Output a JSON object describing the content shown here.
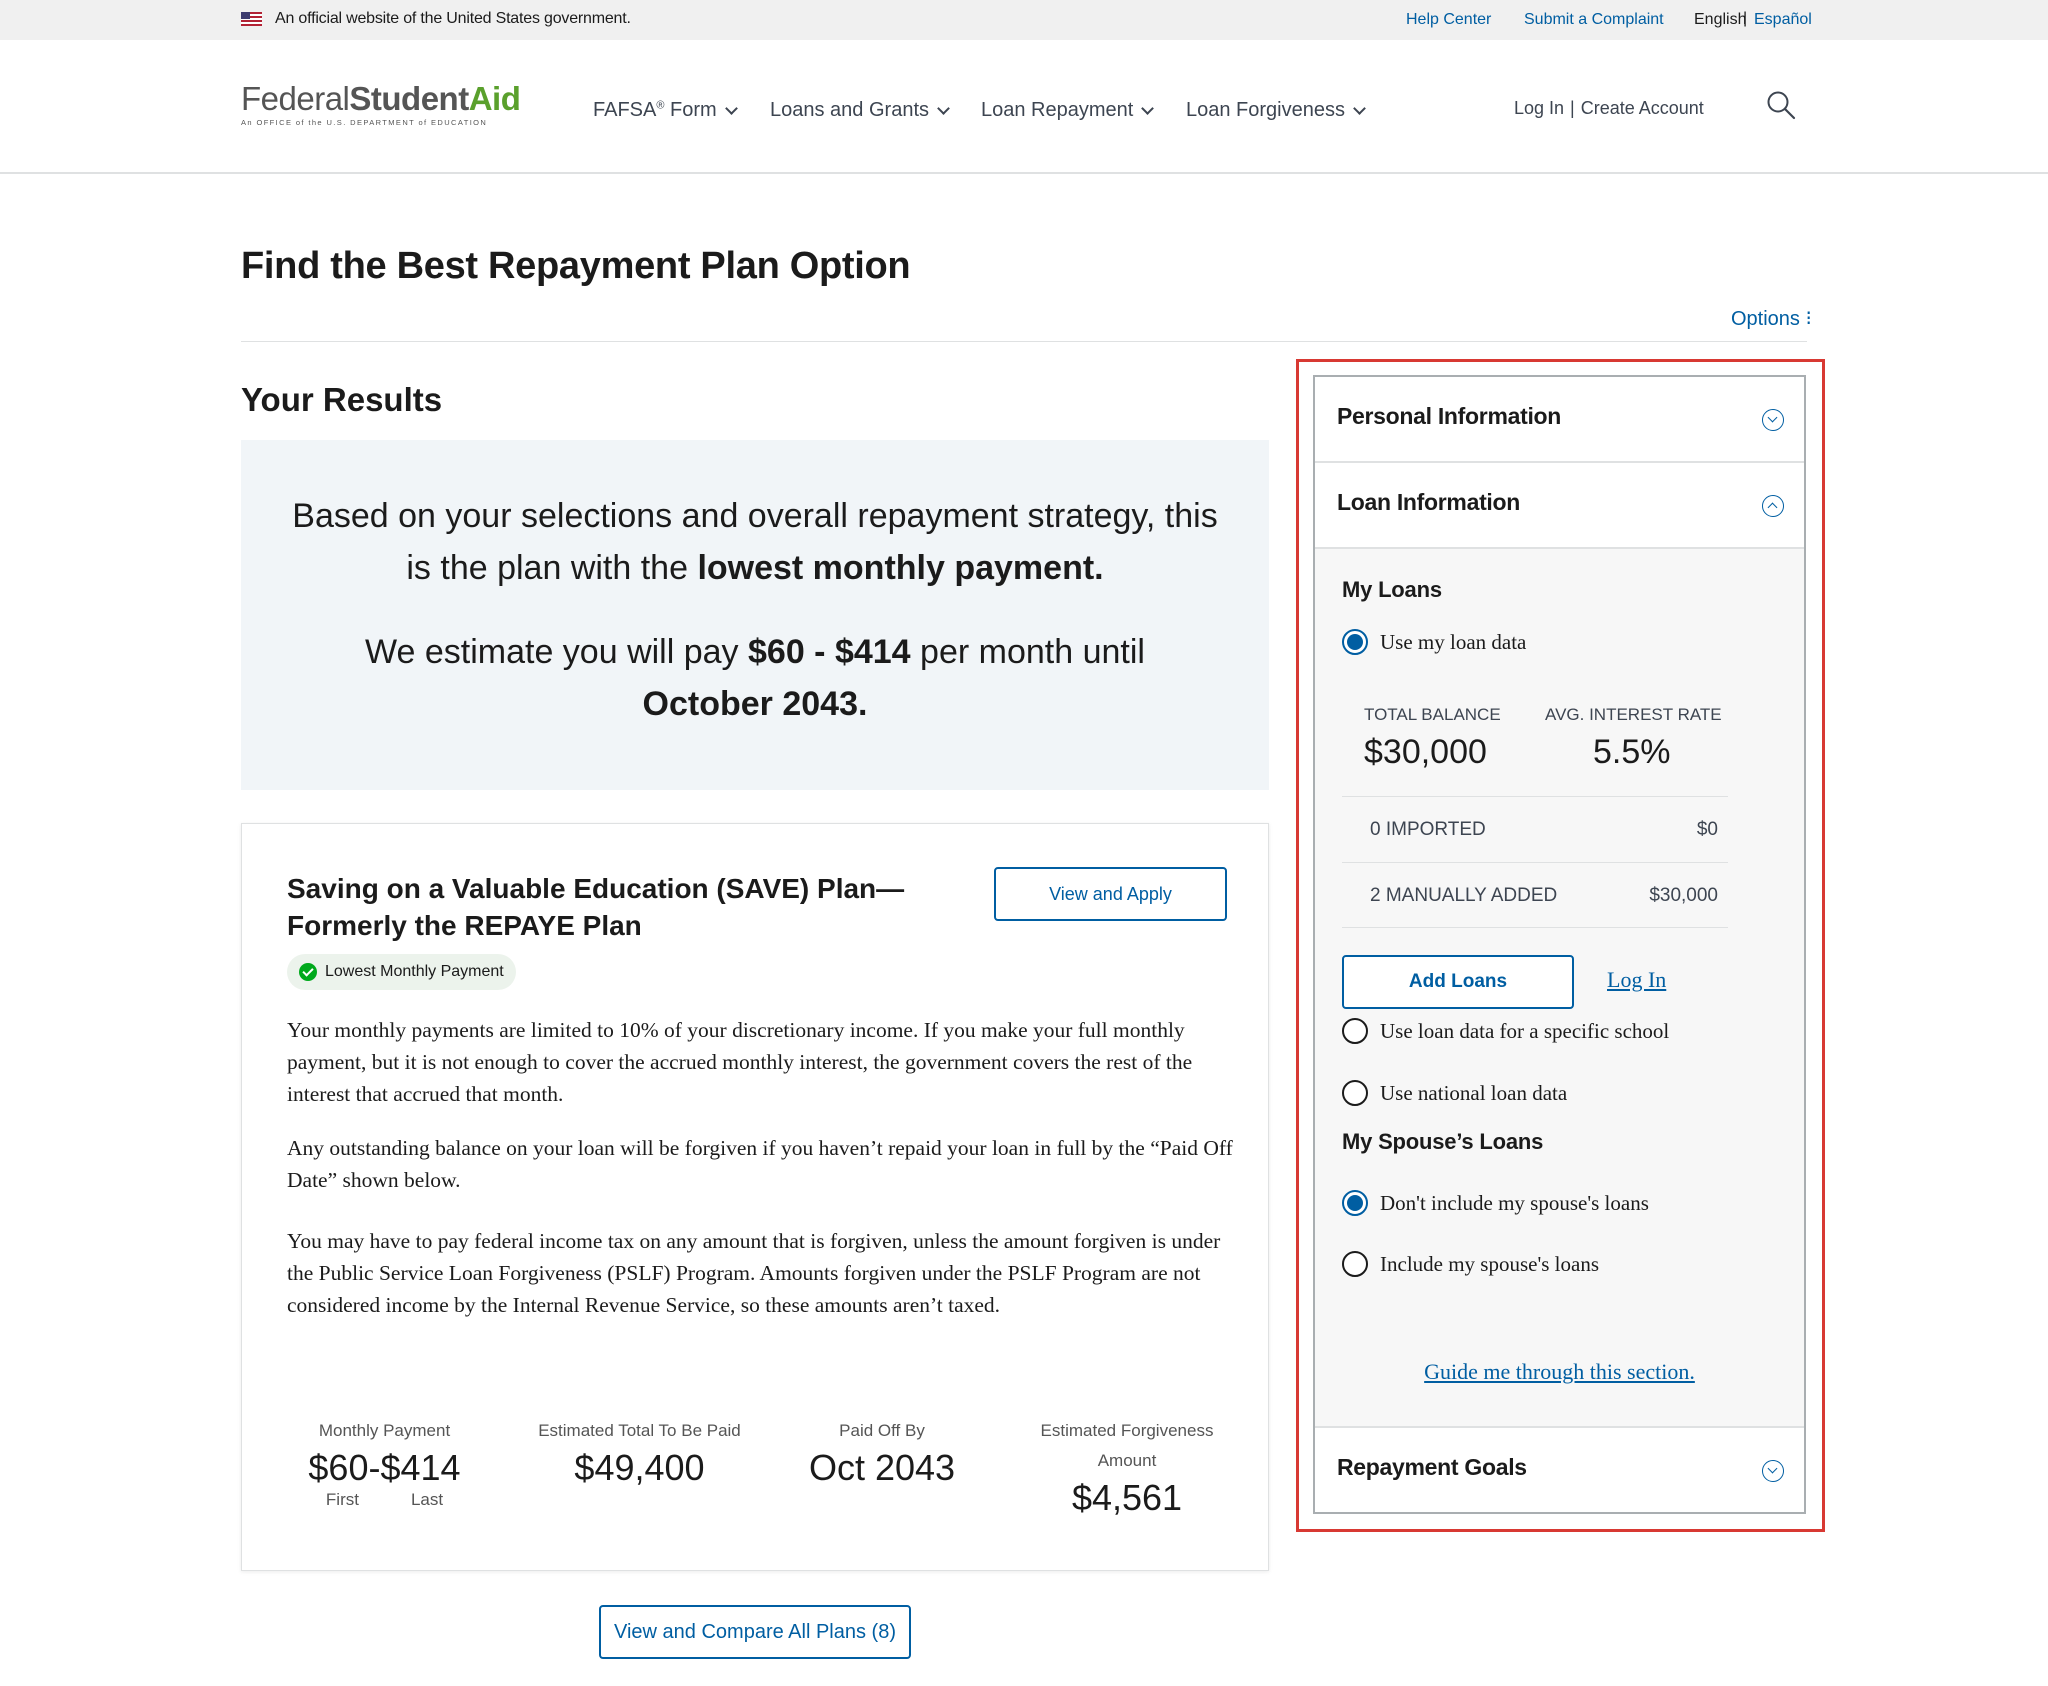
{
  "gov_banner": {
    "text": "An official website of the United States government.",
    "help_center": "Help Center",
    "submit_complaint": "Submit a Complaint",
    "english": "English",
    "separator": "|",
    "espanol": "Español"
  },
  "header": {
    "logo_federal": "Federal",
    "logo_student": "Student",
    "logo_aid": "Aid",
    "logo_sub": "An OFFICE of the U.S. DEPARTMENT of EDUCATION",
    "nav": {
      "fafsa": "FAFSA",
      "fafsa_sup": "®",
      "fafsa_suffix": "Form",
      "loans_grants": "Loans and Grants",
      "loan_repayment": "Loan Repayment",
      "loan_forgiveness": "Loan Forgiveness"
    },
    "login": "Log In",
    "auth_sep": "|",
    "create_account": "Create Account"
  },
  "page": {
    "title": "Find the Best Repayment Plan Option",
    "options": "Options ⁝",
    "results_title": "Your Results"
  },
  "summary": {
    "line1_pre": "Based on your selections and overall repayment strategy, this is the plan with the ",
    "line1_bold": "lowest monthly payment.",
    "line2_pre": "We estimate you will pay ",
    "line2_bold1": "$60 - $414",
    "line2_mid": " per month until ",
    "line2_bold2": "October 2043."
  },
  "plan": {
    "title": "Saving on a Valuable Education (SAVE) Plan—Formerly the REPAYE Plan",
    "view_apply": "View and Apply",
    "badge": "Lowest Monthly Payment",
    "para1": "Your monthly payments are limited to 10% of your discretionary income. If you make your full monthly payment, but it is not enough to cover the accrued monthly interest, the government covers the rest of the interest that accrued that month.",
    "para2": "Any outstanding balance on your loan will be forgiven if you haven’t repaid your loan in full by the “Paid Off Date” shown below.",
    "para3": "You may have to pay federal income tax on any amount that is forgiven, unless the amount forgiven is under the Public Service Loan Forgiveness (PSLF) Program. Amounts forgiven under the PSLF Program are not considered income by the Internal Revenue Service, so these amounts aren’t taxed.",
    "stats": {
      "monthly_label": "Monthly Payment",
      "monthly_first": "$60",
      "monthly_dash": "-",
      "monthly_last": "$414",
      "first_label": "First",
      "last_label": "Last",
      "total_label": "Estimated Total To Be Paid",
      "total_value": "$49,400",
      "paid_off_label": "Paid Off By",
      "paid_off_value": "Oct 2043",
      "forgiveness_label": "Estimated Forgiveness Amount",
      "forgiveness_value": "$4,561"
    }
  },
  "compare_button": "View and Compare All Plans (8)",
  "sidebar": {
    "personal_info": "Personal Information",
    "loan_info": "Loan Information",
    "my_loans": "My Loans",
    "use_my_loan_data": "Use my loan data",
    "total_balance_label": "TOTAL BALANCE",
    "total_balance_value": "$30,000",
    "avg_rate_label": "AVG. INTEREST RATE",
    "avg_rate_value": "5.5%",
    "imported_label": "0 IMPORTED",
    "imported_value": "$0",
    "manual_label": "2 MANUALLY ADDED",
    "manual_value": "$30,000",
    "add_loans": "Add Loans",
    "login": "Log In",
    "specific_school": "Use loan data for a specific school",
    "national_data": "Use national loan data",
    "spouse_heading": "My Spouse’s Loans",
    "dont_include": "Don't include my spouse's loans",
    "include": "Include my spouse's loans",
    "guide": "Guide me through this section.",
    "repayment_goals": "Repayment Goals"
  }
}
